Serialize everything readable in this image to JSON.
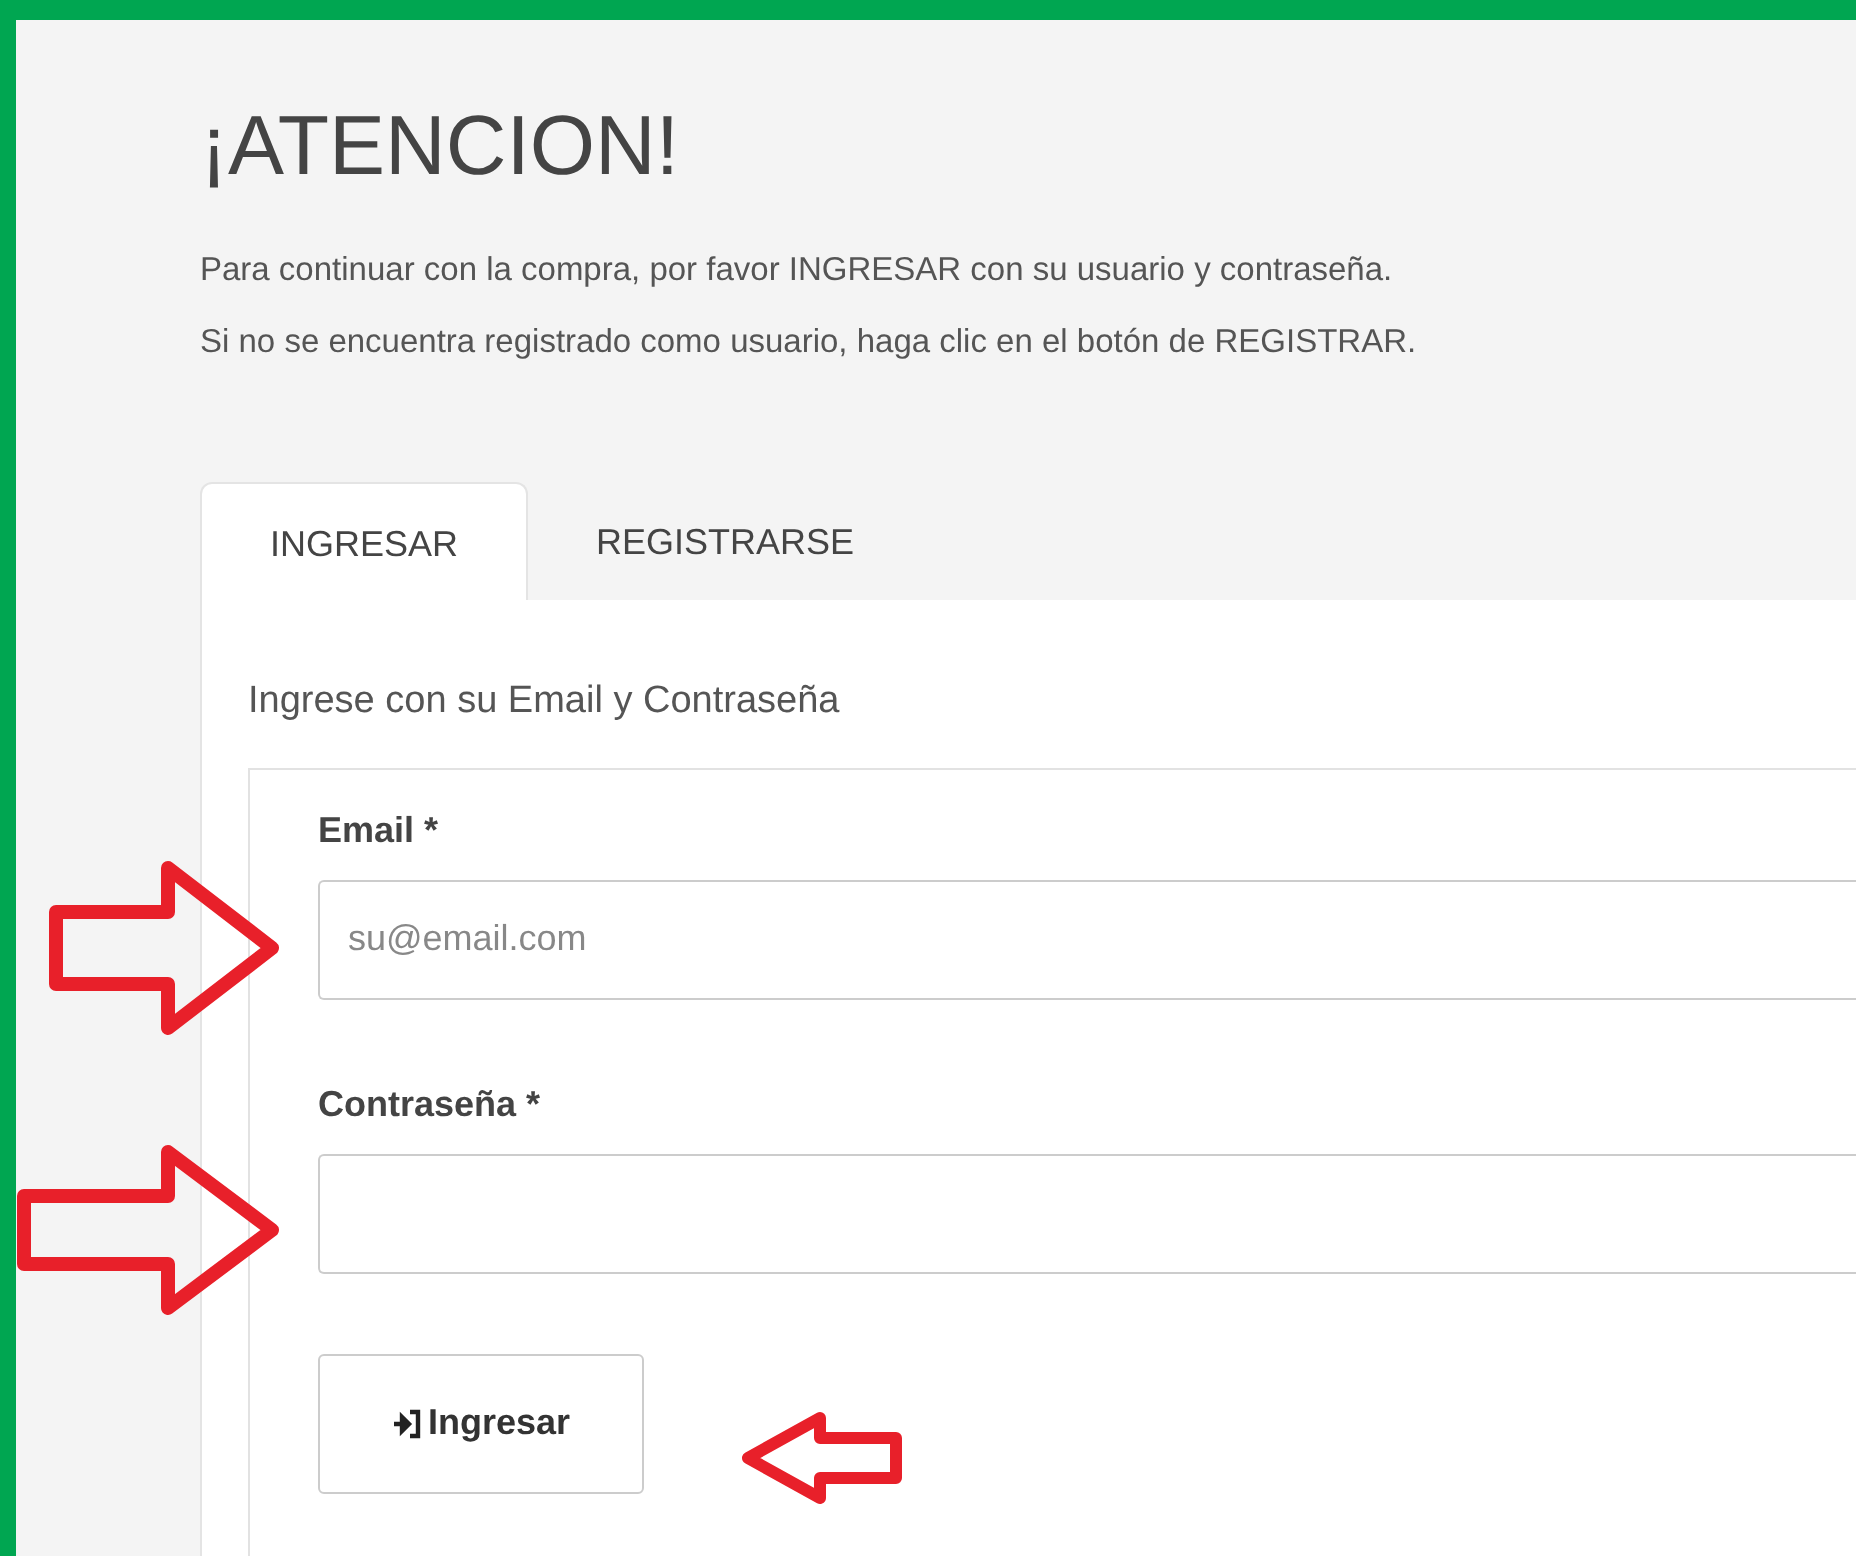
{
  "title": "¡ATENCION!",
  "message": [
    "Para continuar con la compra, por favor INGRESAR con su usuario y contraseña.",
    "Si no se encuentra registrado como usuario, haga clic en el botón de REGISTRAR."
  ],
  "tabs": [
    {
      "label": "INGRESAR",
      "selected": true
    },
    {
      "label": "REGISTRARSE",
      "selected": false
    }
  ],
  "panel": {
    "heading": "Ingrese con su Email y Contraseña",
    "fields": [
      {
        "label": "Email *",
        "placeholder": "su@email.com"
      },
      {
        "label": "Contraseña *"
      }
    ],
    "button": "Ingresar"
  }
}
